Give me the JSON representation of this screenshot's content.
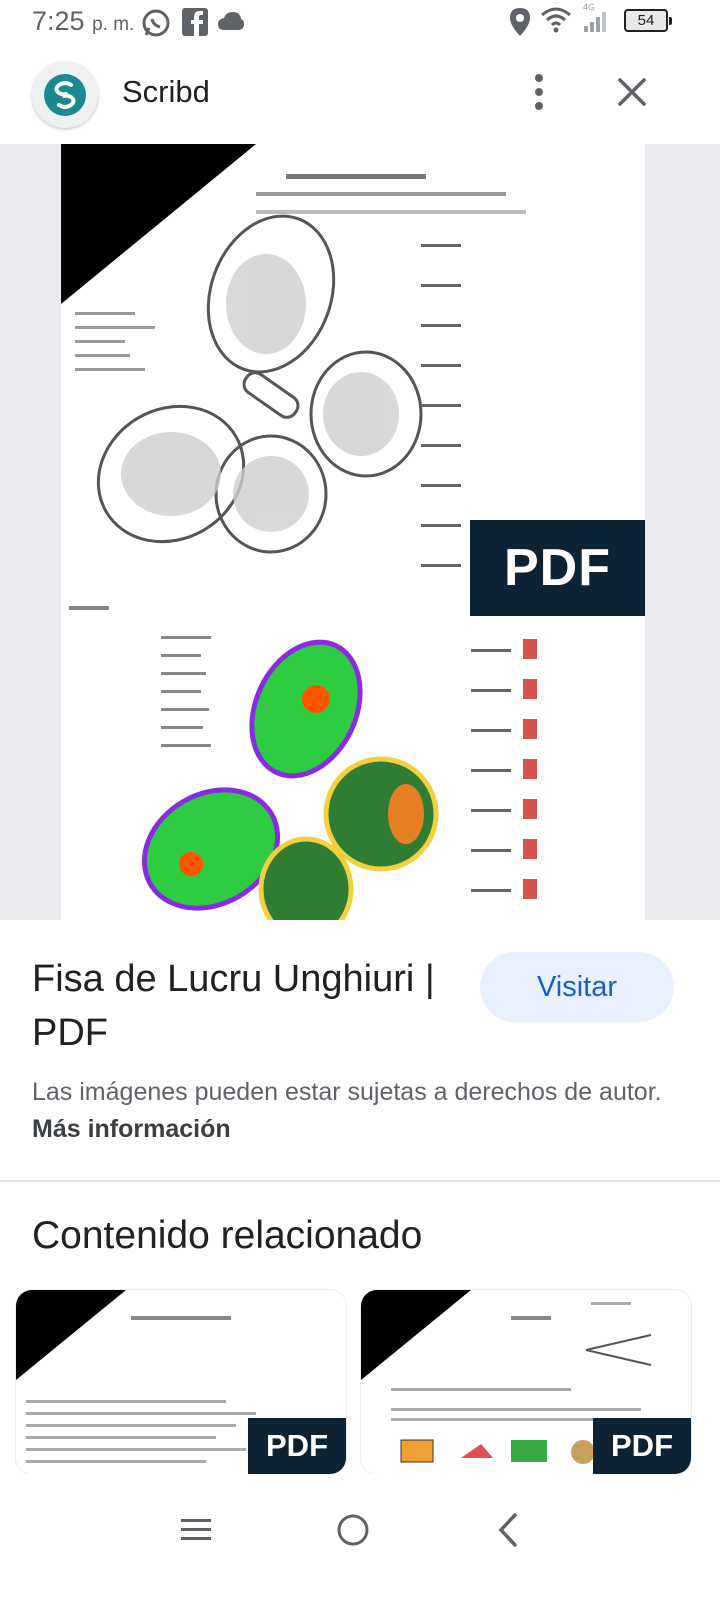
{
  "status_bar": {
    "time": "7:25",
    "period": "p. m.",
    "network": "4G",
    "battery": "54",
    "icons": [
      "whatsapp-icon",
      "facebook-icon",
      "cloud-icon",
      "location-icon",
      "wifi-icon",
      "signal-icon",
      "battery-icon"
    ]
  },
  "header": {
    "app_name": "Scribd",
    "icons": [
      "scribd-logo-icon",
      "more-vert-icon",
      "close-icon"
    ]
  },
  "preview": {
    "badge": "PDF"
  },
  "result": {
    "title": "Fisa de Lucru Unghiuri | PDF",
    "visit_label": "Visitar",
    "copyright_text": "Las imágenes pueden estar sujetas a derechos de autor.",
    "more_info": "Más información"
  },
  "related": {
    "heading": "Contenido relacionado",
    "cards": [
      {
        "badge": "PDF"
      },
      {
        "badge": "PDF"
      }
    ]
  },
  "nav": {
    "icons": [
      "recent-apps-icon",
      "home-icon",
      "back-icon"
    ]
  },
  "colors": {
    "accent": "#1a5fc9",
    "visit_bg": "#e8f0fe",
    "badge_bg": "#0d2233",
    "logo_teal": "#1b8a8f"
  }
}
